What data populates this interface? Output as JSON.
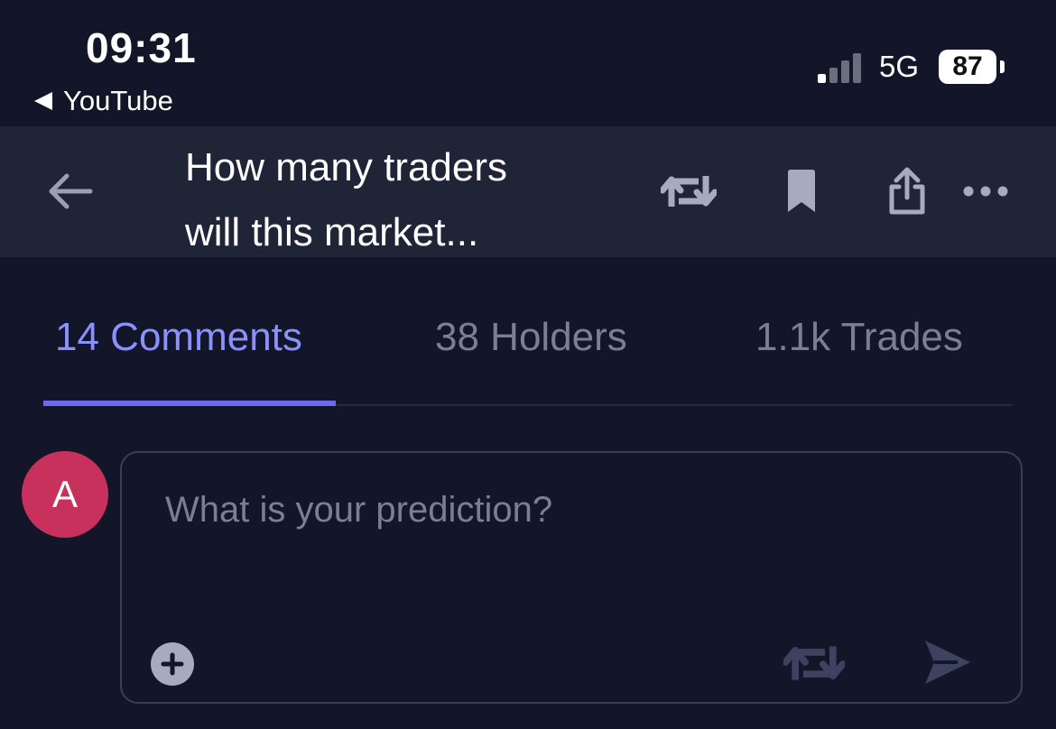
{
  "status_bar": {
    "time": "09:31",
    "back_app_label": "YouTube",
    "network": "5G",
    "battery": "87"
  },
  "header": {
    "title_line1": "How many traders",
    "title_line2": "will this market..."
  },
  "tabs": [
    {
      "label": "14 Comments",
      "active": true
    },
    {
      "label": "38 Holders",
      "active": false
    },
    {
      "label": "1.1k Trades",
      "active": false
    }
  ],
  "composer": {
    "avatar_initial": "A",
    "placeholder": "What is your prediction?"
  },
  "icons": {
    "back": "arrow-left-icon",
    "repost": "repost-icon",
    "bookmark": "bookmark-icon",
    "share": "share-icon",
    "more": "more-icon",
    "add": "plus-circle-icon",
    "send": "send-icon"
  },
  "colors": {
    "background": "#121628",
    "header": "#1f2436",
    "accent": "#8a91ff",
    "avatar": "#c8315b"
  }
}
